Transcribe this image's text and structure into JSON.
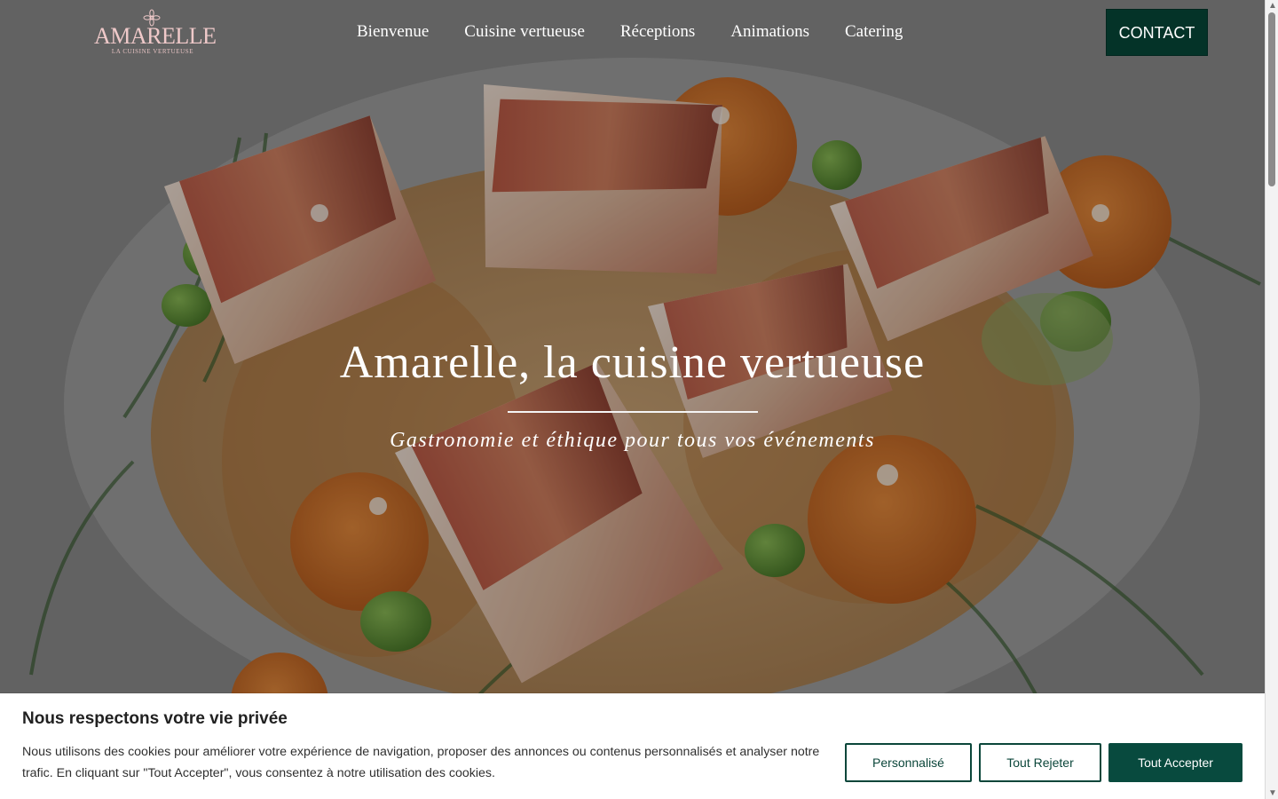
{
  "header": {
    "logo_text": "AMARELLE",
    "logo_tagline": "LA CUISINE VERTUEUSE",
    "nav": [
      "Bienvenue",
      "Cuisine vertueuse",
      "Réceptions",
      "Animations",
      "Catering"
    ],
    "contact_label": "CONTACT"
  },
  "hero": {
    "title": "Amarelle, la cuisine vertueuse",
    "subtitle": "Gastronomie et éthique pour tous vos événements"
  },
  "cookie": {
    "title": "Nous respectons votre vie privée",
    "text": "Nous utilisons des cookies pour améliorer votre expérience de navigation, proposer des annonces ou contenus personnalisés et analyser notre trafic. En cliquant sur \"Tout Accepter\", vous consentez à notre utilisation des cookies.",
    "buttons": {
      "custom": "Personnalisé",
      "reject": "Tout Rejeter",
      "accept": "Tout Accepter"
    }
  },
  "colors": {
    "primary_green": "#084a3e",
    "contact_green": "#043328",
    "logo_pink": "#efc9c9",
    "white": "#ffffff"
  },
  "icons": {
    "logo_mark": "flower-icon",
    "scroll_up": "chevron-up-icon",
    "scroll_down": "chevron-down-icon"
  }
}
